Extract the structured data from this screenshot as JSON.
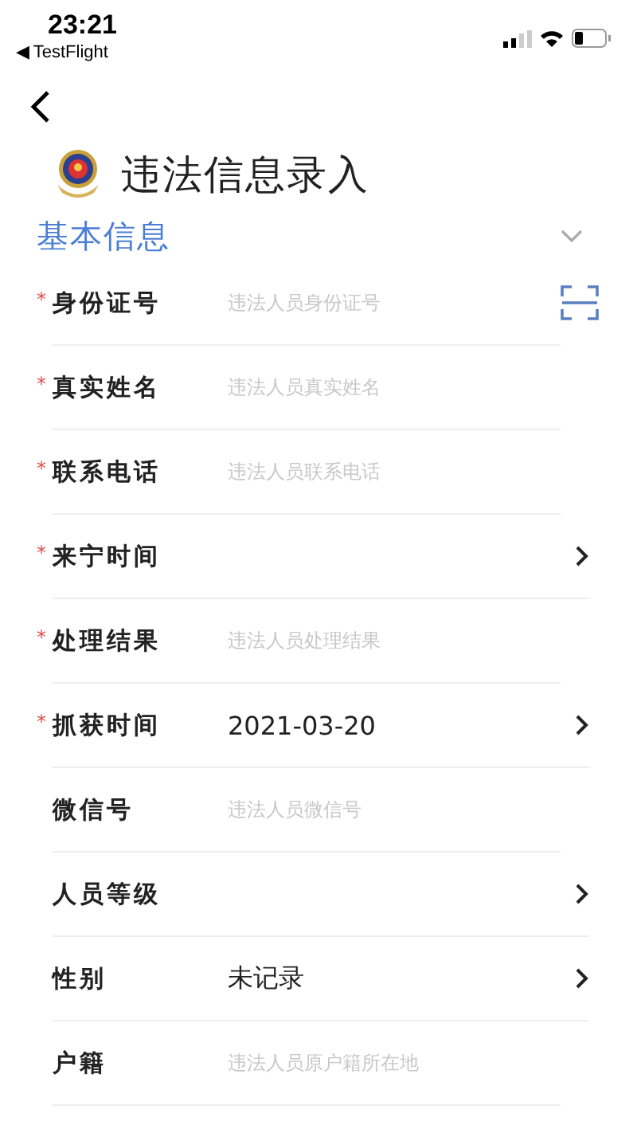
{
  "status_bar": {
    "time": "23:21",
    "back_app": "◀ TestFlight"
  },
  "page": {
    "title": "违法信息录入"
  },
  "section": {
    "title": "基本信息",
    "expanded": true
  },
  "fields": [
    {
      "kind": "input",
      "label": "身份证号",
      "required_mark": "*",
      "placeholder": "违法人员身份证号",
      "scan": true
    },
    {
      "kind": "input",
      "label": "真实姓名",
      "required_mark": "*",
      "placeholder": "违法人员真实姓名"
    },
    {
      "kind": "input",
      "label": "联系电话",
      "required_mark": "*",
      "placeholder": "违法人员联系电话"
    },
    {
      "kind": "picker",
      "label": "来宁时间",
      "required_mark": "*"
    },
    {
      "kind": "input",
      "label": "处理结果",
      "required_mark": "*",
      "placeholder": "违法人员处理结果"
    },
    {
      "kind": "picker",
      "label": "抓获时间",
      "required_mark": "*",
      "value": "2021-03-20"
    },
    {
      "kind": "input",
      "label": "微信号",
      "placeholder": "违法人员微信号"
    },
    {
      "kind": "picker",
      "label": "人员等级"
    },
    {
      "kind": "picker",
      "label": "性别",
      "value": "未记录"
    },
    {
      "kind": "input",
      "label": "户籍",
      "placeholder": "违法人员原户籍所在地"
    }
  ]
}
